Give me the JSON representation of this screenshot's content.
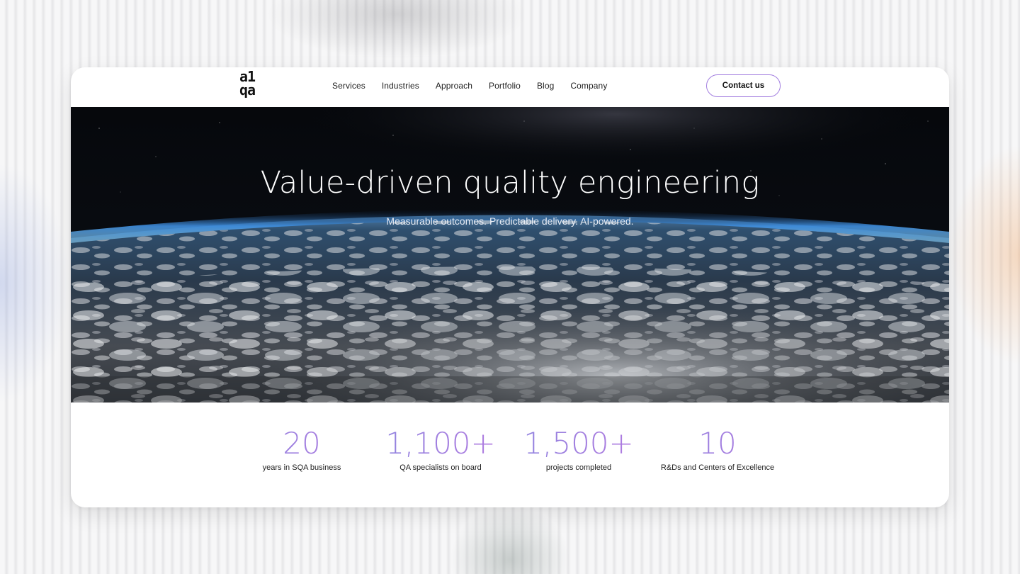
{
  "brand": {
    "logo_line1": "a1",
    "logo_line2": "qa"
  },
  "nav": {
    "items": [
      {
        "label": "Services"
      },
      {
        "label": "Industries"
      },
      {
        "label": "Approach"
      },
      {
        "label": "Portfolio"
      },
      {
        "label": "Blog"
      },
      {
        "label": "Company"
      }
    ],
    "cta_label": "Contact us"
  },
  "hero": {
    "title": "Value-driven quality engineering",
    "subtitle": "Measurable outcomes. Predictable delivery. AI-powered."
  },
  "stats": [
    {
      "value": "20",
      "label": "years in SQA business"
    },
    {
      "value": "1,100+",
      "label": "QA specialists on board"
    },
    {
      "value": "1,500+",
      "label": "projects completed"
    },
    {
      "value": "10",
      "label": "R&Ds and Centers of Excellence"
    }
  ],
  "colors": {
    "accent": "#a47de0",
    "button_border": "#a37fe0"
  }
}
